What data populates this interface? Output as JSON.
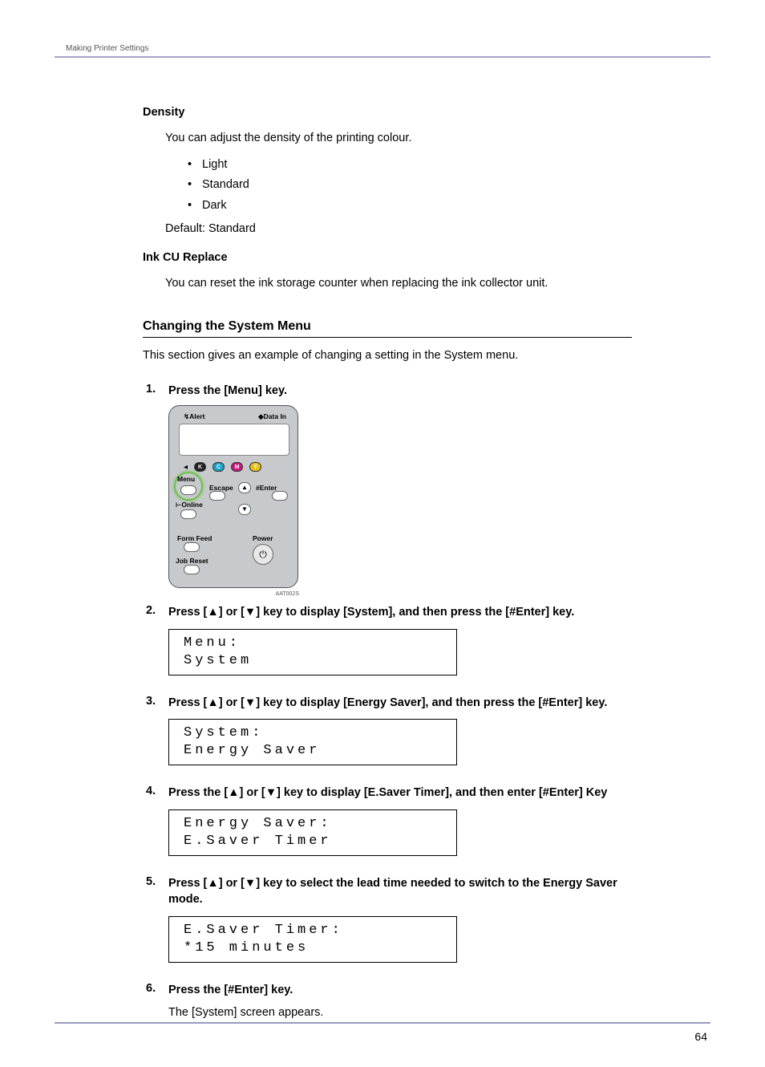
{
  "running_head": "Making Printer Settings",
  "page_number": "64",
  "density": {
    "label": "Density",
    "desc": "You can adjust the density of the printing colour.",
    "options": [
      "Light",
      "Standard",
      "Dark"
    ],
    "default_line": "Default: Standard"
  },
  "ink": {
    "label": "Ink CU Replace",
    "desc": "You can reset the ink storage counter when replacing the ink collector unit."
  },
  "section": {
    "heading": "Changing the System Menu",
    "intro": "This section gives an example of changing a setting in the System menu."
  },
  "panel": {
    "alert": "Alert",
    "data_in": "Data In",
    "menu": "Menu",
    "escape": "Escape",
    "enter": "#Enter",
    "online": "Online",
    "form_feed": "Form Feed",
    "job_reset": "Job Reset",
    "power": "Power",
    "ink_k": "K",
    "ink_c": "C",
    "ink_m": "M",
    "ink_y": "Y",
    "up": "▲",
    "down": "▼",
    "pwr_glyph": "⏻",
    "code": "AAT002S"
  },
  "steps": [
    {
      "text": "Press the [Menu] key.",
      "lcd": null,
      "show_panel": true
    },
    {
      "text": "Press [▲] or [▼] key to display [System], and then press the [#Enter] key.",
      "lcd": "Menu:\nSystem"
    },
    {
      "text": "Press [▲] or [▼] key to display [Energy Saver], and then press the [#Enter] key.",
      "lcd": "System:\nEnergy Saver"
    },
    {
      "text": "Press the [▲] or [▼] key to display [E.Saver Timer], and then enter [#Enter] Key",
      "lcd": "Energy Saver:\nE.Saver Timer"
    },
    {
      "text": "Press [▲] or [▼] key to select the lead time needed to switch to the Energy Saver mode.",
      "lcd": "E.Saver Timer:\n*15 minutes"
    },
    {
      "text": "Press the [#Enter] key.",
      "note": "The [System] screen appears."
    }
  ]
}
